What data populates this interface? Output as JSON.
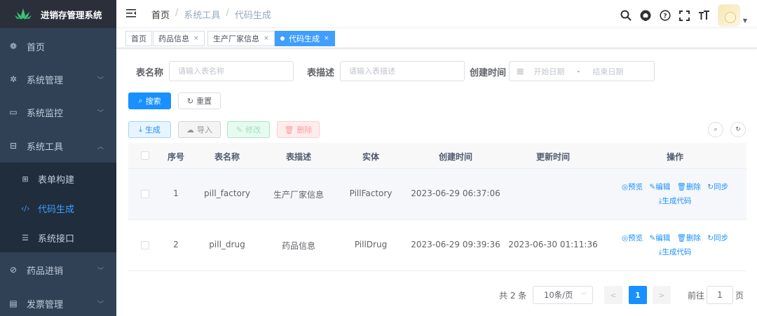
{
  "app": {
    "title": "进销存管理系统"
  },
  "sidebar": {
    "items": [
      {
        "label": "首页",
        "icon": "dashboard-icon"
      },
      {
        "label": "系统管理",
        "icon": "system-icon",
        "arrow": "﹀"
      },
      {
        "label": "系统监控",
        "icon": "monitor-icon",
        "arrow": "﹀"
      },
      {
        "label": "系统工具",
        "icon": "tool-icon",
        "arrow": "︿"
      },
      {
        "label": "药品进销",
        "icon": "drug-icon",
        "arrow": "﹀"
      },
      {
        "label": "发票管理",
        "icon": "invoice-icon",
        "arrow": "﹀"
      }
    ],
    "sub_items": [
      {
        "label": "表单构建",
        "icon": "form-icon"
      },
      {
        "label": "代码生成",
        "icon": "code-icon"
      },
      {
        "label": "系统接口",
        "icon": "swagger-icon"
      }
    ]
  },
  "breadcrumb": {
    "home": "首页",
    "sep": "/",
    "level1": "系统工具",
    "level2": "代码生成"
  },
  "tags": [
    {
      "label": "首页"
    },
    {
      "label": "药品信息",
      "close": "×"
    },
    {
      "label": "生产厂家信息",
      "close": "×"
    },
    {
      "label": "代码生成",
      "close": "×"
    }
  ],
  "search": {
    "table_name_label": "表名称",
    "table_name_placeholder": "请输入表名称",
    "table_desc_label": "表描述",
    "table_desc_placeholder": "请输入表描述",
    "create_time_label": "创建时间",
    "start_placeholder": "开始日期",
    "range_sep": "-",
    "end_placeholder": "结束日期",
    "search_btn": "搜索",
    "reset_btn": "重置"
  },
  "toolbar": {
    "generate": "生成",
    "import": "导入",
    "edit": "修改",
    "delete": "删除"
  },
  "table": {
    "headers": [
      "序号",
      "表名称",
      "表描述",
      "实体",
      "创建时间",
      "更新时间",
      "操作"
    ],
    "rows": [
      {
        "index": "1",
        "table_name": "pill_factory",
        "table_desc": "生产厂家信息",
        "entity": "PillFactory",
        "create_time": "2023-06-29 06:37:06",
        "update_time": ""
      },
      {
        "index": "2",
        "table_name": "pill_drug",
        "table_desc": "药品信息",
        "entity": "PillDrug",
        "create_time": "2023-06-29 09:39:36",
        "update_time": "2023-06-30 01:11:36"
      }
    ],
    "ops": {
      "preview": "◎预览",
      "edit": "✎编辑",
      "delete": "🗑删除",
      "sync": "↻同步",
      "gen": "⤓生成代码"
    }
  },
  "pagination": {
    "total": "共 2 条",
    "page_size": "10条/页",
    "current": "1",
    "goto": "前往",
    "goto_value": "1",
    "page_unit": "页",
    "prev": "<",
    "next": ">"
  },
  "colors": {
    "sidebar_bg": "#304156",
    "primary": "#1890ff",
    "active_menu": "#409eff"
  }
}
